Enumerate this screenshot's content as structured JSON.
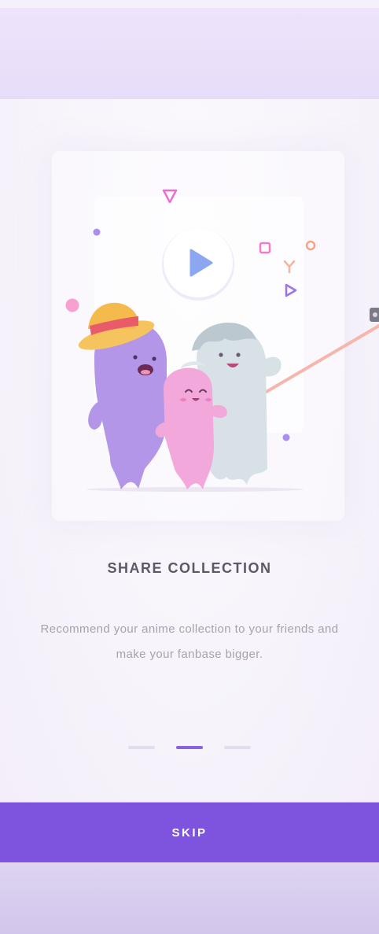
{
  "onboarding": {
    "title": "SHARE COLLECTION",
    "description": "Recommend your anime collection to your friends and make your fanbase bigger.",
    "pager": {
      "total": 3,
      "active_index": 1
    },
    "skip_label": "SKIP"
  },
  "illustration": {
    "play_button_icon": "play-icon",
    "characters": [
      "purple-ghost-with-straw-hat",
      "pink-ghost",
      "grey-ghost"
    ],
    "accessory": "selfie-stick"
  },
  "colors": {
    "accent": "#7e54df",
    "pager_active": "#8b62dd",
    "pager_inactive": "#e3dcef",
    "title": "#5c5868",
    "description": "#a6a2b0"
  }
}
